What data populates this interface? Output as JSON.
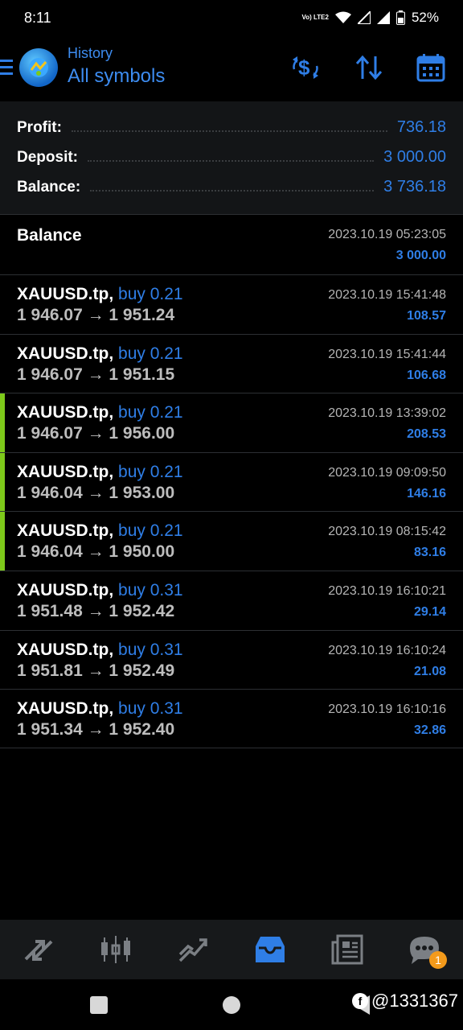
{
  "status_bar": {
    "time": "8:11",
    "network": "Vo) LTE2",
    "battery": "52%"
  },
  "header": {
    "subtitle": "History",
    "title": "All symbols"
  },
  "summary": [
    {
      "label": "Profit:",
      "value": "736.18"
    },
    {
      "label": "Deposit:",
      "value": "3 000.00"
    },
    {
      "label": "Balance:",
      "value": "3 736.18"
    }
  ],
  "balance_entry": {
    "label": "Balance",
    "datetime": "2023.10.19 05:23:05",
    "amount": "3 000.00"
  },
  "trades": [
    {
      "symbol": "XAUUSD.tp,",
      "side": "buy 0.21",
      "prices": "1 946.07 → 1 951.24",
      "datetime": "2023.10.19 15:41:48",
      "profit": "108.57",
      "highlight": false
    },
    {
      "symbol": "XAUUSD.tp,",
      "side": "buy 0.21",
      "prices": "1 946.07 → 1 951.15",
      "datetime": "2023.10.19 15:41:44",
      "profit": "106.68",
      "highlight": false
    },
    {
      "symbol": "XAUUSD.tp,",
      "side": "buy 0.21",
      "prices": "1 946.07 → 1 956.00",
      "datetime": "2023.10.19 13:39:02",
      "profit": "208.53",
      "highlight": true
    },
    {
      "symbol": "XAUUSD.tp,",
      "side": "buy 0.21",
      "prices": "1 946.04 → 1 953.00",
      "datetime": "2023.10.19 09:09:50",
      "profit": "146.16",
      "highlight": true
    },
    {
      "symbol": "XAUUSD.tp,",
      "side": "buy 0.21",
      "prices": "1 946.04 → 1 950.00",
      "datetime": "2023.10.19 08:15:42",
      "profit": "83.16",
      "highlight": true
    },
    {
      "symbol": "XAUUSD.tp,",
      "side": "buy 0.31",
      "prices": "1 951.48 → 1 952.42",
      "datetime": "2023.10.19 16:10:21",
      "profit": "29.14",
      "highlight": false
    },
    {
      "symbol": "XAUUSD.tp,",
      "side": "buy 0.31",
      "prices": "1 951.81 → 1 952.49",
      "datetime": "2023.10.19 16:10:24",
      "profit": "21.08",
      "highlight": false
    },
    {
      "symbol": "XAUUSD.tp,",
      "side": "buy 0.31",
      "prices": "1 951.34 → 1 952.40",
      "datetime": "2023.10.19 16:10:16",
      "profit": "32.86",
      "highlight": false
    }
  ],
  "bottom_nav": {
    "items": [
      "quotes-icon",
      "chart-icon",
      "trade-icon",
      "history-icon",
      "news-icon",
      "chat-icon"
    ],
    "active": "history-icon",
    "chat_badge": "1"
  },
  "watermark": "@1331367",
  "colors": {
    "accent": "#2f7ee6",
    "profit_bar": "#7dc91a",
    "badge": "#f39a1b"
  }
}
